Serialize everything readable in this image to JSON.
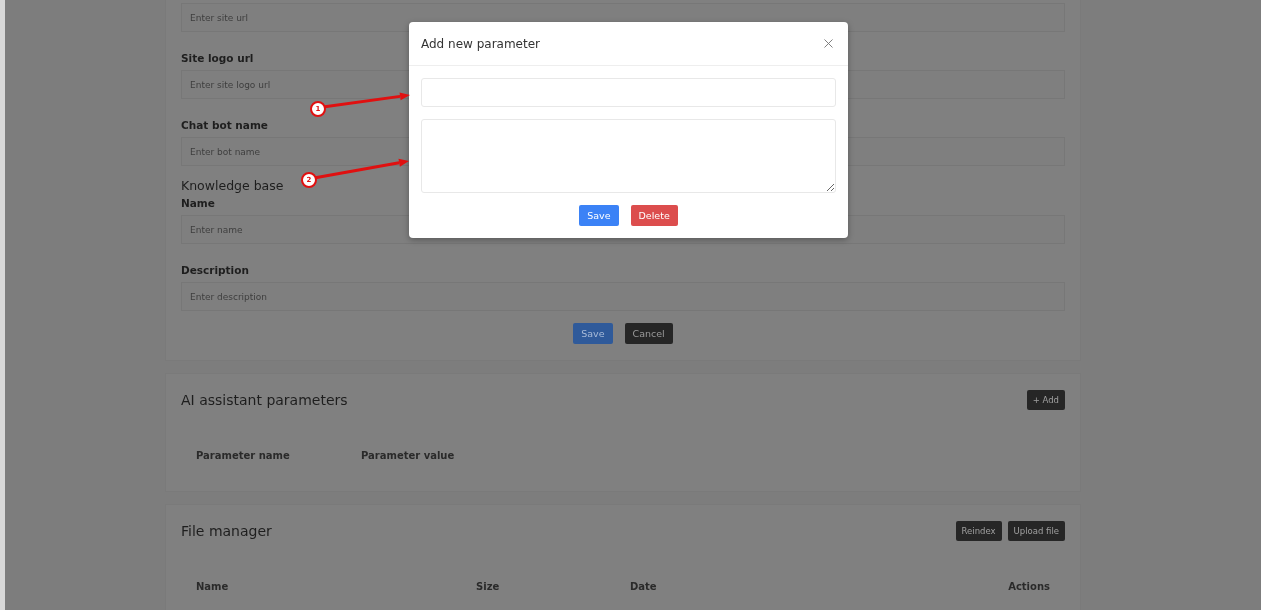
{
  "form": {
    "items": [
      {
        "kind": "input",
        "placeholder": "Enter site url"
      },
      {
        "kind": "input",
        "label": "Site logo url",
        "placeholder": "Enter site logo url"
      },
      {
        "kind": "input",
        "label": "Chat bot name",
        "placeholder": "Enter bot name"
      },
      {
        "kind": "heading",
        "label": "Knowledge base"
      },
      {
        "kind": "input",
        "label": "Name",
        "placeholder": "Enter name"
      },
      {
        "kind": "input",
        "label": "Description",
        "placeholder": "Enter description"
      }
    ],
    "buttons": [
      {
        "label": "Save",
        "kind": "primary"
      },
      {
        "label": "Cancel",
        "kind": "dark"
      }
    ]
  },
  "sections": [
    {
      "title": "AI assistant parameters",
      "actions": [
        "+ Add"
      ],
      "columns": [
        "Parameter name",
        "Parameter value"
      ]
    },
    {
      "title": "File manager",
      "actions": [
        "Reindex",
        "Upload file"
      ],
      "columns": [
        "Name",
        "Size",
        "Date",
        "Actions"
      ]
    }
  ],
  "modal": {
    "title": "Add new parameter",
    "fields": [
      {
        "kind": "input"
      },
      {
        "kind": "textarea"
      }
    ],
    "buttons": [
      {
        "label": "Save",
        "kind": "primary"
      },
      {
        "label": "Delete",
        "kind": "danger"
      }
    ]
  },
  "annotations": [
    {
      "label": "1"
    },
    {
      "label": "2"
    }
  ]
}
